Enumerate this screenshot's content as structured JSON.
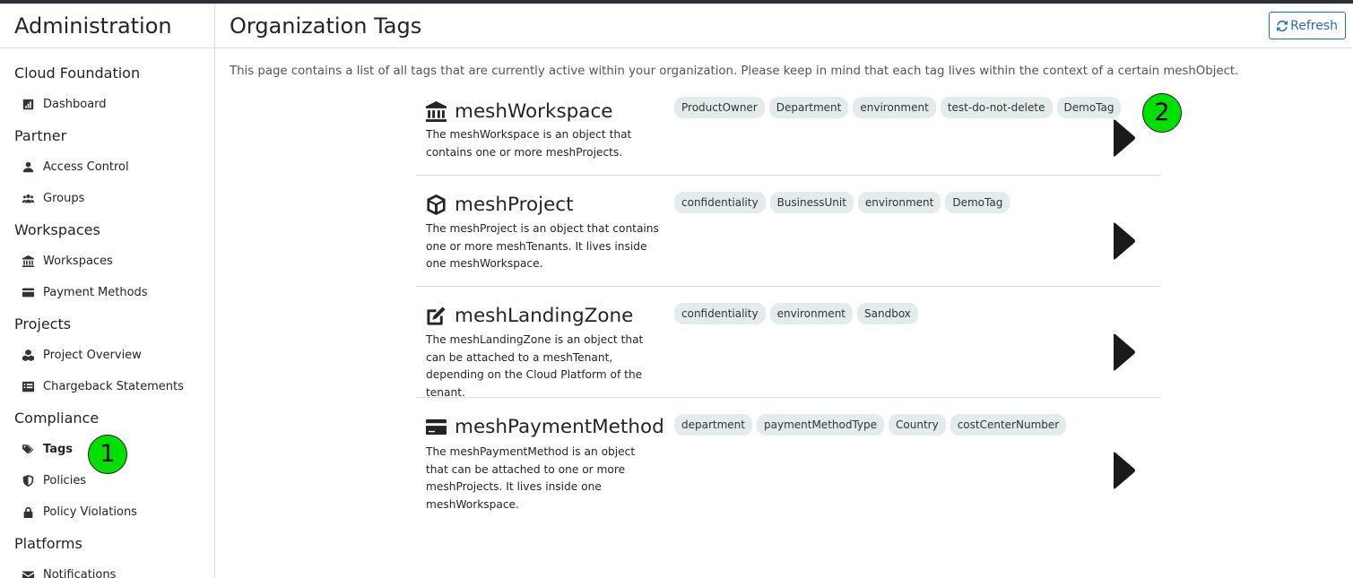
{
  "sidebar": {
    "title": "Administration",
    "sections": [
      {
        "label": "Cloud Foundation",
        "items": [
          {
            "label": "Dashboard",
            "icon": "dashboard-icon"
          }
        ]
      },
      {
        "label": "Partner",
        "items": [
          {
            "label": "Access Control",
            "icon": "user-icon"
          },
          {
            "label": "Groups",
            "icon": "users-icon"
          }
        ]
      },
      {
        "label": "Workspaces",
        "items": [
          {
            "label": "Workspaces",
            "icon": "bank-icon"
          },
          {
            "label": "Payment Methods",
            "icon": "credit-card-icon"
          }
        ]
      },
      {
        "label": "Projects",
        "items": [
          {
            "label": "Project Overview",
            "icon": "cubes-icon"
          },
          {
            "label": "Chargeback Statements",
            "icon": "list-icon"
          }
        ]
      },
      {
        "label": "Compliance",
        "items": [
          {
            "label": "Tags",
            "icon": "tags-icon",
            "active": true
          },
          {
            "label": "Policies",
            "icon": "shield-icon"
          },
          {
            "label": "Policy Violations",
            "icon": "lock-icon"
          }
        ]
      },
      {
        "label": "Platforms",
        "items": [
          {
            "label": "Notifications",
            "icon": "envelope-icon"
          }
        ]
      }
    ]
  },
  "header": {
    "title": "Organization Tags",
    "refresh_label": "Refresh"
  },
  "intro": "This page contains a list of all tags that are currently active within your organization. Please keep in mind that each tag lives within the context of a certain meshObject.",
  "objects": [
    {
      "name": "meshWorkspace",
      "icon": "bank-icon",
      "description": "The meshWorkspace is an object that contains one or more meshProjects.",
      "tags": [
        "ProductOwner",
        "Department",
        "environment",
        "test-do-not-delete",
        "DemoTag"
      ]
    },
    {
      "name": "meshProject",
      "icon": "cube-icon",
      "description": "The meshProject is an object that contains one or more meshTenants. It lives inside one meshWorkspace.",
      "tags": [
        "confidentiality",
        "BusinessUnit",
        "environment",
        "DemoTag"
      ]
    },
    {
      "name": "meshLandingZone",
      "icon": "edit-icon",
      "description": "The meshLandingZone is an object that can be attached to a meshTenant, depending on the Cloud Platform of the tenant.",
      "tags": [
        "confidentiality",
        "environment",
        "Sandbox"
      ]
    },
    {
      "name": "meshPaymentMethod",
      "icon": "credit-card-icon",
      "description": "The meshPaymentMethod is an object that can be attached to one or more meshProjects. It lives inside one meshWorkspace.",
      "tags": [
        "department",
        "paymentMethodType",
        "Country",
        "costCenterNumber"
      ]
    }
  ],
  "markers": [
    "1",
    "2"
  ],
  "colors": {
    "accent": "#1f6fb5",
    "tag_bg": "#e3ecec",
    "marker": "#00e000"
  }
}
